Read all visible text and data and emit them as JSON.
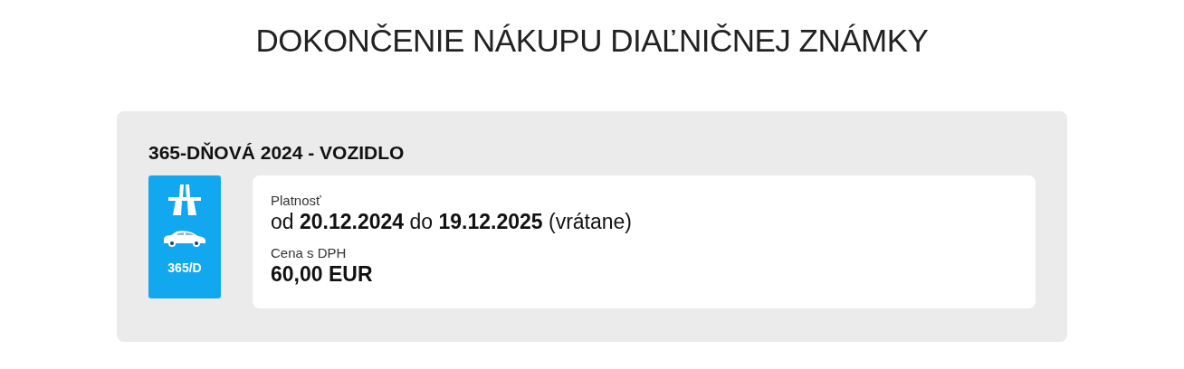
{
  "page_title": "DOKONČENIE NÁKUPU DIAĽNIČNEJ ZNÁMKY",
  "card": {
    "heading": "365-DŇOVÁ 2024 - VOZIDLO",
    "sticker": {
      "label": "365/D"
    },
    "validity": {
      "label": "Platnosť",
      "value": "od **20.12.2024** do **19.12.2025** (vrátane)"
    },
    "price": {
      "label": "Cena s DPH",
      "value": "60,00 EUR"
    }
  }
}
